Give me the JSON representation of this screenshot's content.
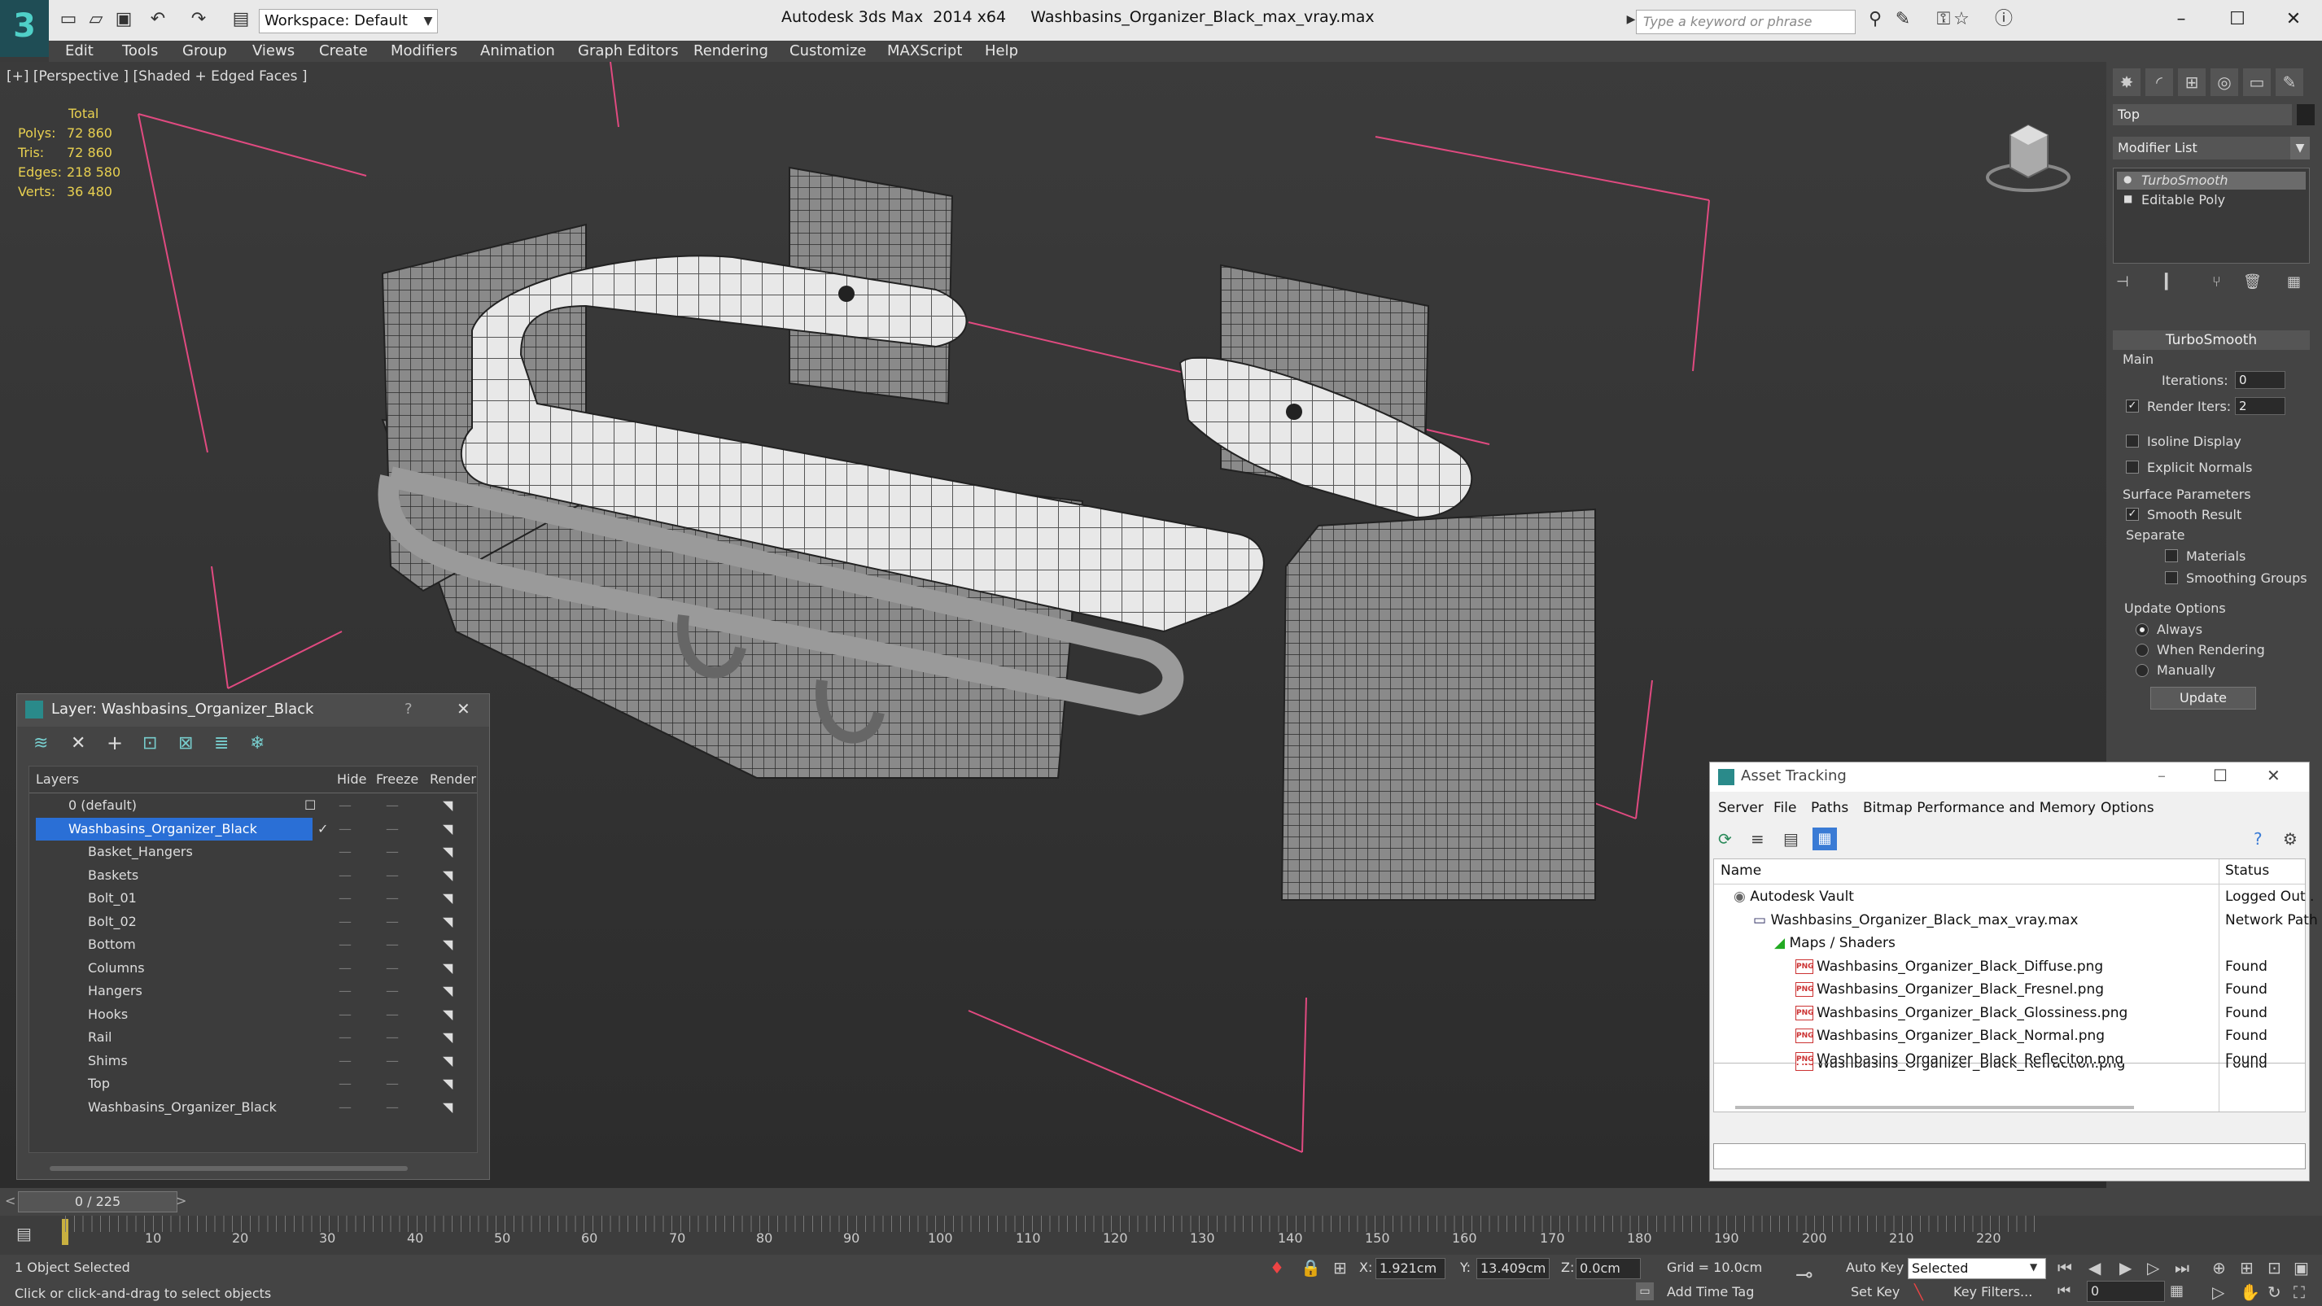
{
  "titlebar": {
    "app_title": "Autodesk 3ds Max  2014 x64     Washbasins_Organizer_Black_max_vray.max",
    "workspace": "Workspace: Default",
    "search_placeholder": "Type a keyword or phrase"
  },
  "menu": [
    "Edit",
    "Tools",
    "Group",
    "Views",
    "Create",
    "Modifiers",
    "Animation",
    "Graph Editors",
    "Rendering",
    "Customize",
    "MAXScript",
    "Help"
  ],
  "viewport": {
    "label": "[+] [Perspective ] [Shaded + Edged Faces ]",
    "stats": {
      "header": "Total",
      "rows": [
        {
          "label": "Polys:",
          "value": "72 860"
        },
        {
          "label": "Tris:",
          "value": "72 860"
        },
        {
          "label": "Edges:",
          "value": "218 580"
        },
        {
          "label": "Verts:",
          "value": "36 480"
        }
      ]
    }
  },
  "command_panel": {
    "object_name": "Top",
    "modifier_list": "Modifier List",
    "stack": [
      "TurboSmooth",
      "Editable Poly"
    ],
    "rollout_title": "TurboSmooth",
    "main_group": "Main",
    "iterations_label": "Iterations:",
    "iterations_value": "0",
    "render_iters_label": "Render Iters:",
    "render_iters_value": "2",
    "isoline": "Isoline Display",
    "explicit_normals": "Explicit Normals",
    "surface_params": "Surface Parameters",
    "smooth_result": "Smooth Result",
    "separate": "Separate",
    "materials": "Materials",
    "smoothing_groups": "Smoothing Groups",
    "update_options": "Update Options",
    "always": "Always",
    "when_rendering": "When Rendering",
    "manually": "Manually",
    "update_btn": "Update"
  },
  "layer_dialog": {
    "title": "Layer: Washbasins_Organizer_Black",
    "help": "?",
    "columns": {
      "layers": "Layers",
      "hide": "Hide",
      "freeze": "Freeze",
      "render": "Render"
    },
    "rows": [
      {
        "name": "0 (default)",
        "level": 0
      },
      {
        "name": "Washbasins_Organizer_Black",
        "level": 0
      },
      {
        "name": "Basket_Hangers",
        "level": 1
      },
      {
        "name": "Baskets",
        "level": 1
      },
      {
        "name": "Bolt_01",
        "level": 1
      },
      {
        "name": "Bolt_02",
        "level": 1
      },
      {
        "name": "Bottom",
        "level": 1
      },
      {
        "name": "Columns",
        "level": 1
      },
      {
        "name": "Hangers",
        "level": 1
      },
      {
        "name": "Hooks",
        "level": 1
      },
      {
        "name": "Rail",
        "level": 1
      },
      {
        "name": "Shims",
        "level": 1
      },
      {
        "name": "Top",
        "level": 1
      },
      {
        "name": "Washbasins_Organizer_Black",
        "level": 1
      }
    ]
  },
  "asset_dialog": {
    "title": "Asset Tracking",
    "menu": [
      "Server",
      "File",
      "Paths",
      "Bitmap Performance and Memory",
      "Options"
    ],
    "columns": {
      "name": "Name",
      "status": "Status"
    },
    "rows": [
      {
        "name": "Autodesk Vault",
        "status": "Logged Out ."
      },
      {
        "name": "Washbasins_Organizer_Black_max_vray.max",
        "status": "Network Path"
      },
      {
        "name": "Maps / Shaders",
        "status": ""
      },
      {
        "name": "Washbasins_Organizer_Black_Diffuse.png",
        "status": "Found"
      },
      {
        "name": "Washbasins_Organizer_Black_Fresnel.png",
        "status": "Found"
      },
      {
        "name": "Washbasins_Organizer_Black_Glossiness.png",
        "status": "Found"
      },
      {
        "name": "Washbasins_Organizer_Black_Normal.png",
        "status": "Found"
      },
      {
        "name": "Washbasins_Organizer_Black_Refleciton.png",
        "status": "Found"
      },
      {
        "name": "Washbasins_Organizer_Black_Refraction.png",
        "status": "Found"
      }
    ]
  },
  "timeline": {
    "frame": "0 / 225",
    "ticks": [
      "10",
      "20",
      "30",
      "40",
      "50",
      "60",
      "70",
      "80",
      "90",
      "100",
      "110",
      "120",
      "130",
      "140",
      "150",
      "160",
      "170",
      "180",
      "190",
      "200",
      "210",
      "220"
    ]
  },
  "status": {
    "selected": "1 Object Selected",
    "hint": "Click or click-and-drag to select objects",
    "x_label": "X:",
    "x_value": "1.921cm",
    "y_label": "Y:",
    "y_value": "13.409cm",
    "z_label": "Z:",
    "z_value": "0.0cm",
    "grid": "Grid = 10.0cm",
    "auto_key": "Auto Key",
    "set_key": "Set Key",
    "selected_dropdown": "Selected",
    "key_filters": "Key Filters...",
    "add_time_tag": "Add Time Tag",
    "frame_value": "0"
  },
  "colors": {
    "accent": "#4fd0c8",
    "selection": "#2a6fd6",
    "stat_text": "#e8d050"
  }
}
